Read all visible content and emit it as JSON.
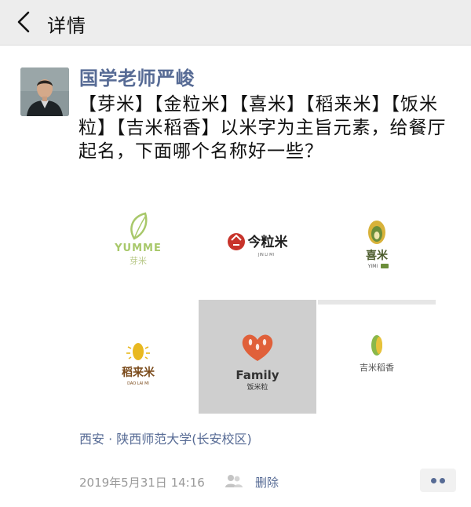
{
  "header": {
    "title": "详情",
    "back_icon": "chevron-left-icon"
  },
  "post": {
    "author": "国学老师严峻",
    "text": "【芽米】【金粒米】【喜米】【稻来米】【饭米粒】【吉米稻香】以米字为主旨元素，给餐厅起名，下面哪个名称好一些？",
    "location": "西安 · 陕西师范大学(长安校区)",
    "timestamp": "2019年5月31日 14:16",
    "delete_label": "删除",
    "visibility_icon": "friends-icon"
  },
  "images": [
    {
      "name": "YUMME",
      "subtitle": "芽米",
      "accent": "#a8c86a"
    },
    {
      "name": "今粒米",
      "subtitle": "JIN LI MI",
      "accent": "#c8342b"
    },
    {
      "name": "喜米",
      "subtitle": "YIMI",
      "accent": "#6b8e3a"
    },
    {
      "name": "稻来米",
      "subtitle": "DAO LAI MI",
      "accent": "#e8b820"
    },
    {
      "name": "Family",
      "subtitle": "饭米粒",
      "accent": "#e0603a"
    },
    {
      "name": "吉米稻香",
      "subtitle": "",
      "accent": "#8ab84a"
    }
  ],
  "colors": {
    "link": "#576b95",
    "meta": "#9a9a9a",
    "header_bg": "#ededed"
  }
}
